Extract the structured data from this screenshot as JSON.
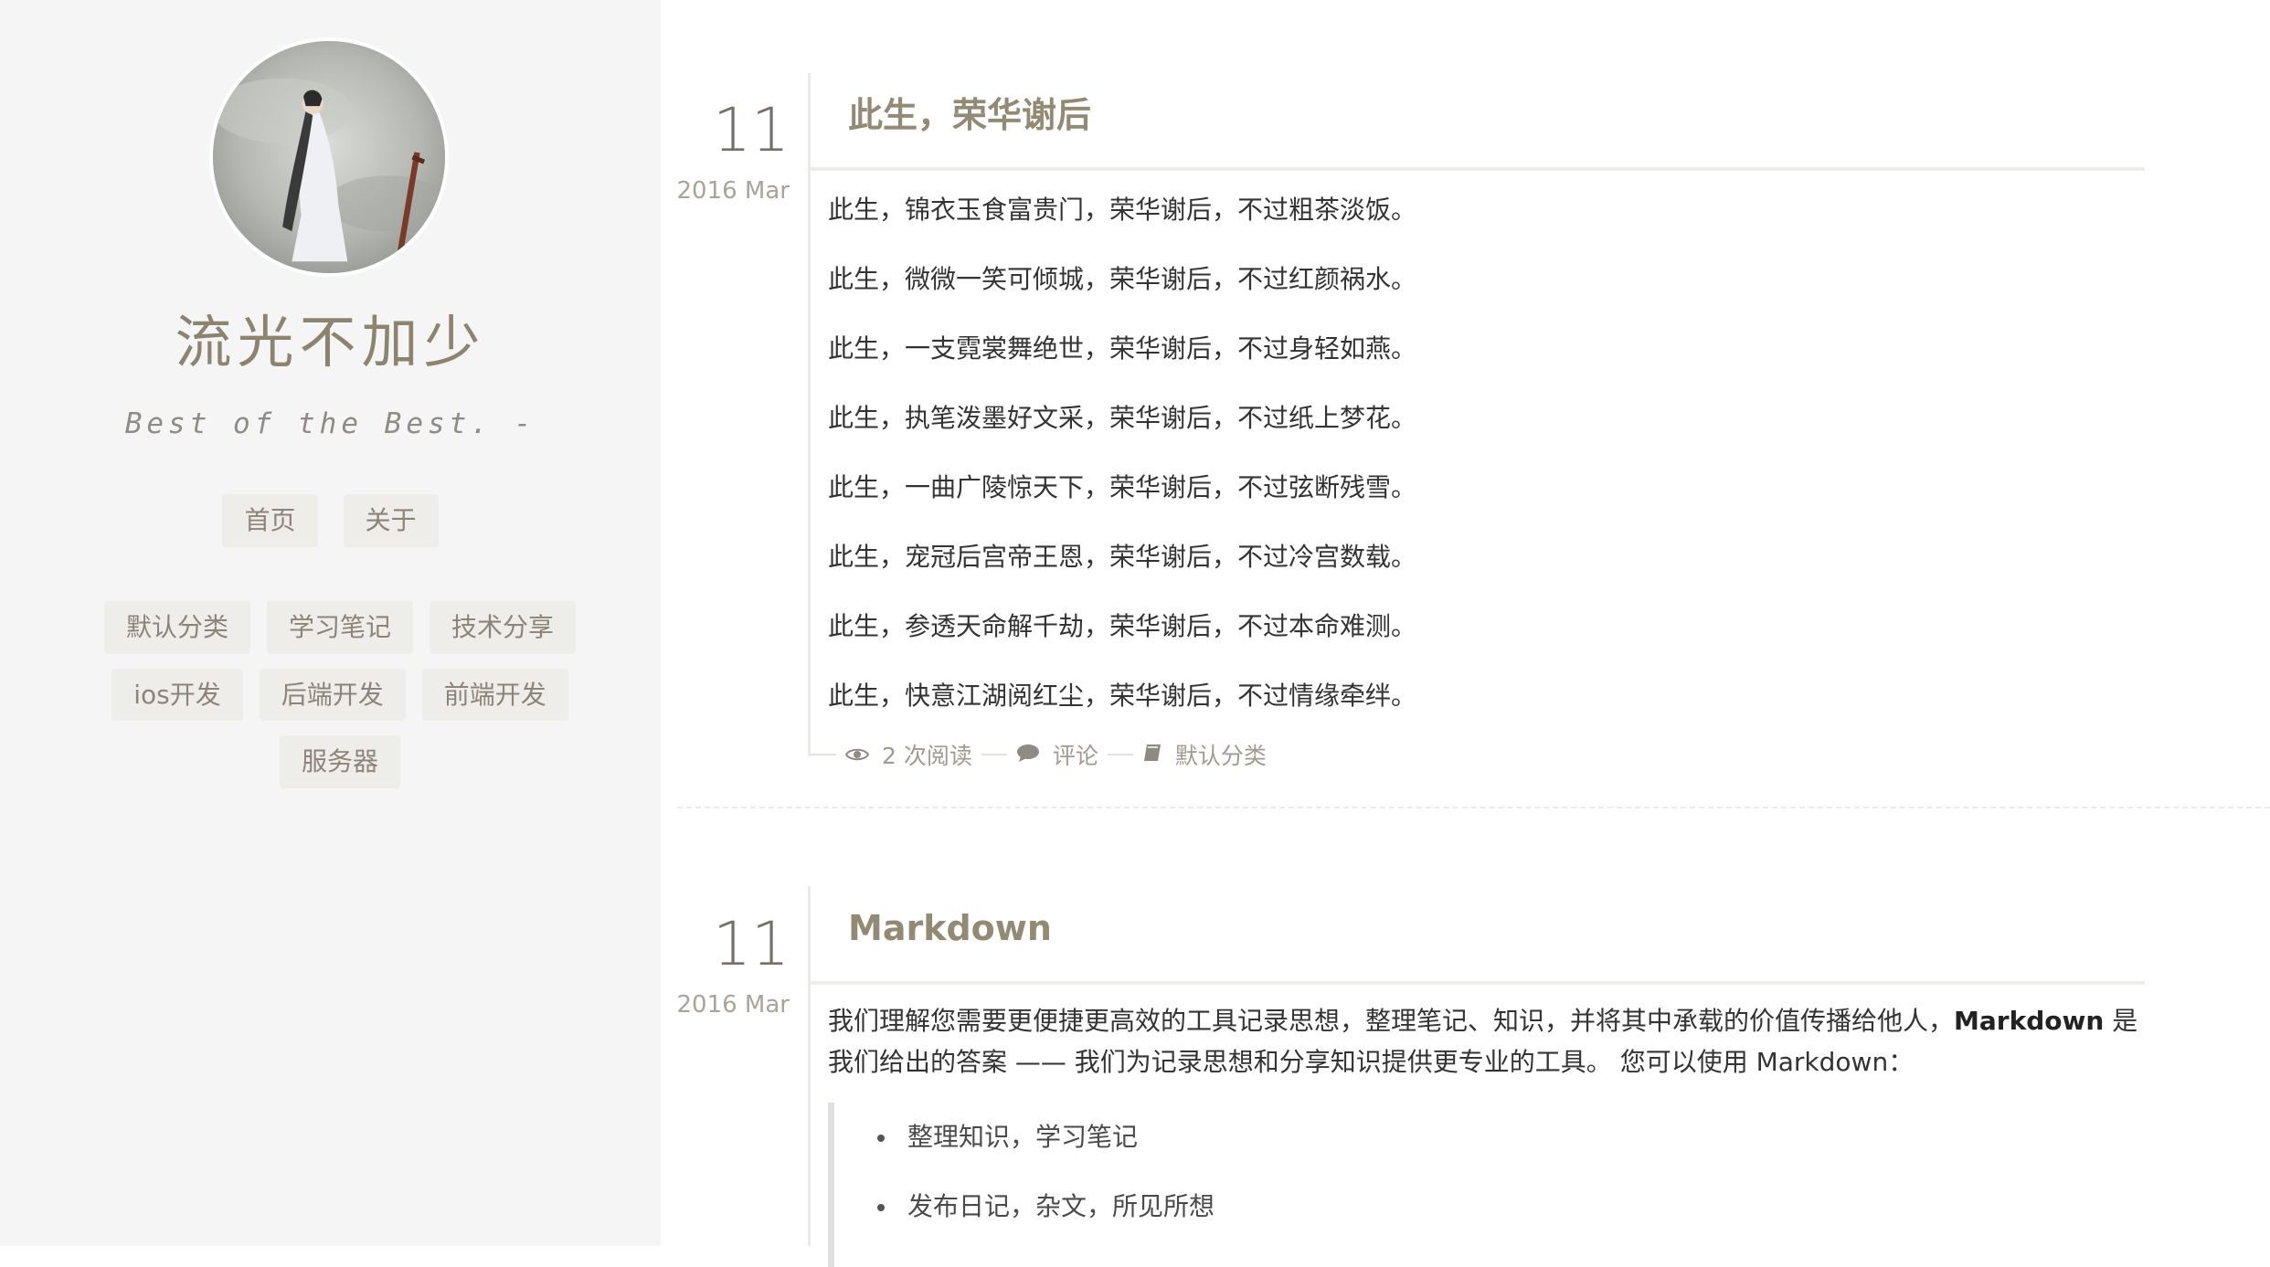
{
  "sidebar": {
    "title": "流光不加少",
    "subtitle": "Best of the Best. -",
    "nav": [
      {
        "label": "首页"
      },
      {
        "label": "关于"
      }
    ],
    "categories": [
      {
        "label": "默认分类"
      },
      {
        "label": "学习笔记"
      },
      {
        "label": "技术分享"
      },
      {
        "label": "ios开发"
      },
      {
        "label": "后端开发"
      },
      {
        "label": "前端开发"
      },
      {
        "label": "服务器"
      }
    ]
  },
  "posts": [
    {
      "day": "11",
      "month": "2016 Mar",
      "title": "此生，荣华谢后",
      "lines": [
        "此生，锦衣玉食富贵门，荣华谢后，不过粗茶淡饭。",
        "此生，微微一笑可倾城，荣华谢后，不过红颜祸水。",
        "此生，一支霓裳舞绝世，荣华谢后，不过身轻如燕。",
        "此生，执笔泼墨好文采，荣华谢后，不过纸上梦花。",
        "此生，一曲广陵惊天下，荣华谢后，不过弦断残雪。",
        "此生，宠冠后宫帝王恩，荣华谢后，不过冷宫数载。",
        "此生，参透天命解千劫，荣华谢后，不过本命难测。",
        "此生，快意江湖阅红尘，荣华谢后，不过情缘牵绊。"
      ],
      "meta": {
        "views": "2 次阅读",
        "comments": "评论",
        "category": "默认分类"
      }
    },
    {
      "day": "11",
      "month": "2016 Mar",
      "title": "Markdown",
      "intro_part1": "我们理解您需要更便捷更高效的工具记录思想，整理笔记、知识，并将其中承载的价值传播给他人，",
      "intro_bold": "Markdown",
      "intro_part2": " 是我们给出的答案 —— 我们为记录思想和分享知识提供更专业的工具。 您可以使用 Markdown：",
      "list": [
        "整理知识，学习笔记",
        "发布日记，杂文，所见所想"
      ]
    }
  ],
  "icons": {
    "views": "eye-icon",
    "comments": "comment-icon",
    "category": "book-icon"
  }
}
